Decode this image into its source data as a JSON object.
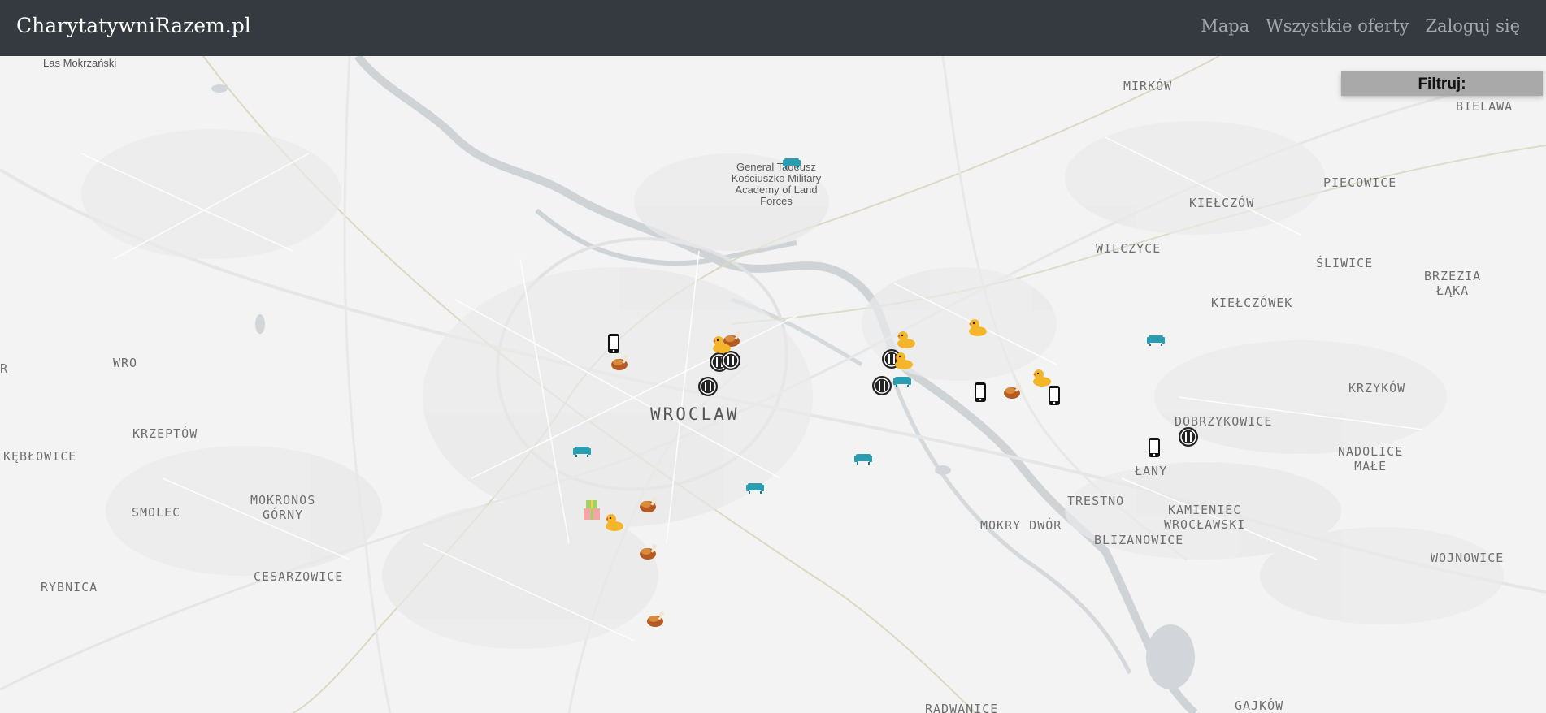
{
  "navbar": {
    "brand": "CharytatywniRazem.pl",
    "links": [
      "Mapa",
      "Wszystkie oferty",
      "Zaloguj się"
    ],
    "bg_color": "#343a40"
  },
  "filter": {
    "title": "Filtruj:"
  },
  "map": {
    "city": "WROCLAW",
    "places": [
      {
        "name": "Las Mokrzański"
      },
      {
        "name": "MIRKÓW"
      },
      {
        "name": "BIELAWA"
      },
      {
        "name": "PIECOWICE"
      },
      {
        "name": "KIEŁCZÓW"
      },
      {
        "name": "WILCZYCE"
      },
      {
        "name": "ŚLIWICE"
      },
      {
        "name": "BRZEZIA\nŁĄKA"
      },
      {
        "name": "KIEŁCZÓWEK"
      },
      {
        "name": "WRO"
      },
      {
        "name": "KRZYKÓW"
      },
      {
        "name": "DOBRZYKOWICE"
      },
      {
        "name": "KRZEPTÓW"
      },
      {
        "name": "KĘBŁOWICE"
      },
      {
        "name": "NADOLICE\nMAŁE"
      },
      {
        "name": "ŁANY"
      },
      {
        "name": "SMOLEC"
      },
      {
        "name": "MOKRONOS\nGÓRNY"
      },
      {
        "name": "TRESTNO"
      },
      {
        "name": "KAMIENIEC\nWROCŁAWSKI"
      },
      {
        "name": "MOKRY DWÓR"
      },
      {
        "name": "BLIZANOWICE"
      },
      {
        "name": "CESARZOWICE"
      },
      {
        "name": "RYBNICA"
      },
      {
        "name": "RADWANICE"
      },
      {
        "name": "GAJKÓW"
      },
      {
        "name": "WOJNOWICE"
      },
      {
        "name": "R"
      }
    ],
    "poi": "General Tadeusz\nKościuszko\nMilitary Academy\nof Land Forces",
    "markers": [
      {
        "type": "furniture-icon"
      },
      {
        "type": "phone-icon"
      },
      {
        "type": "food-icon"
      },
      {
        "type": "food-icon"
      },
      {
        "type": "food-icon"
      },
      {
        "type": "chicken-icon"
      },
      {
        "type": "duck-toy-icon"
      },
      {
        "type": "chicken-icon"
      },
      {
        "type": "food-icon"
      },
      {
        "type": "duck-toy-icon"
      },
      {
        "type": "duck-toy-icon"
      },
      {
        "type": "food-icon"
      },
      {
        "type": "furniture-icon"
      },
      {
        "type": "duck-toy-icon"
      },
      {
        "type": "phone-icon"
      },
      {
        "type": "chicken-icon"
      },
      {
        "type": "duck-toy-icon"
      },
      {
        "type": "phone-icon"
      },
      {
        "type": "furniture-icon"
      },
      {
        "type": "phone-icon"
      },
      {
        "type": "food-icon"
      },
      {
        "type": "furniture-icon"
      },
      {
        "type": "furniture-icon"
      },
      {
        "type": "furniture-icon"
      },
      {
        "type": "gift-icon"
      },
      {
        "type": "duck-toy-icon"
      },
      {
        "type": "chicken-icon"
      },
      {
        "type": "chicken-icon"
      },
      {
        "type": "chicken-icon"
      }
    ],
    "colors": {
      "water": "#cfd3d6",
      "road": "#ffffff",
      "rail": "#d9d9c4",
      "furniture": "#2a9db0",
      "food": "#222222",
      "duck": "#f5b52a"
    }
  }
}
